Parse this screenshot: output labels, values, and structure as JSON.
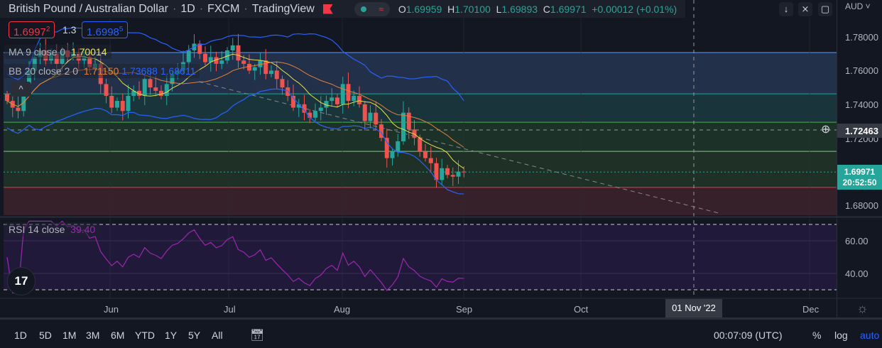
{
  "header": {
    "title": "British Pound / Australian Dollar",
    "interval": "1D",
    "exchange": "FXCM",
    "source": "TradingView",
    "open_label": "O",
    "open": "1.69959",
    "high_label": "H",
    "high": "1.70100",
    "low_label": "L",
    "low": "1.69893",
    "close_label": "C",
    "close": "1.69971",
    "change": "+0.00012 (+0.01%)",
    "market_status_icon": "wave-icon"
  },
  "quote": {
    "bid": "1.6997",
    "bid_sup": "2",
    "spread": "1.3",
    "ask": "1.6998",
    "ask_sup": "5"
  },
  "indicators": {
    "ma_label": "MA 9 close 0",
    "ma_value": "1.70014",
    "bb_label": "BB 20 close 2 0",
    "bb_basis": "1.71150",
    "bb_upper": "1.73688",
    "bb_lower": "1.68611",
    "rsi_label": "RSI 14 close",
    "rsi_value": "39.40"
  },
  "price_axis": {
    "currency": "AUD",
    "ticks": [
      "1.78000",
      "1.76000",
      "1.74000",
      "1.72000",
      "1.68000"
    ],
    "crosshair_price": "1.72463",
    "last_price": "1.69971",
    "countdown": "20:52:50",
    "rsi_ticks": [
      "60.00",
      "40.00"
    ]
  },
  "time_axis": {
    "ticks": [
      "Jun",
      "Jul",
      "Aug",
      "Sep",
      "Oct",
      "Dec"
    ],
    "crosshair_date": "01 Nov '22"
  },
  "toolbar": {
    "ranges": [
      "1D",
      "5D",
      "1M",
      "3M",
      "6M",
      "YTD",
      "1Y",
      "5Y",
      "All"
    ],
    "clock": "00:07:09 (UTC)",
    "percent": "%",
    "log": "log",
    "auto": "auto"
  },
  "colors": {
    "up": "#26a69a",
    "down": "#ef5350",
    "ma": "#e8e14a",
    "bb_basis": "#e0803a",
    "bb_bands": "#2962ff",
    "rsi": "#9c27b0",
    "accent": "#2962ff"
  },
  "chart_data": {
    "type": "candlestick",
    "closes": [
      1.742,
      1.738,
      1.736,
      1.748,
      1.76,
      1.768,
      1.772,
      1.766,
      1.77,
      1.764,
      1.772,
      1.768,
      1.77,
      1.766,
      1.768,
      1.762,
      1.764,
      1.752,
      1.745,
      1.738,
      1.742,
      1.736,
      1.745,
      1.748,
      1.745,
      1.755,
      1.75,
      1.748,
      1.745,
      1.752,
      1.758,
      1.76,
      1.765,
      1.772,
      1.776,
      1.77,
      1.765,
      1.768,
      1.764,
      1.766,
      1.772,
      1.775,
      1.766,
      1.764,
      1.76,
      1.762,
      1.766,
      1.758,
      1.76,
      1.755,
      1.75,
      1.745,
      1.738,
      1.74,
      1.735,
      1.732,
      1.736,
      1.738,
      1.742,
      1.744,
      1.74,
      1.752,
      1.742,
      1.745,
      1.74,
      1.73,
      1.735,
      1.728,
      1.72,
      1.708,
      1.712,
      1.718,
      1.735,
      1.725,
      1.72,
      1.712,
      1.708,
      1.705,
      1.695,
      1.702,
      1.698,
      1.697,
      1.7,
      1.69971
    ],
    "fib_levels": [
      1.7707,
      1.7462,
      1.7293,
      1.712,
      1.6906
    ],
    "ylim": [
      1.672,
      1.79
    ],
    "rsi_levels": [
      70,
      30
    ]
  }
}
